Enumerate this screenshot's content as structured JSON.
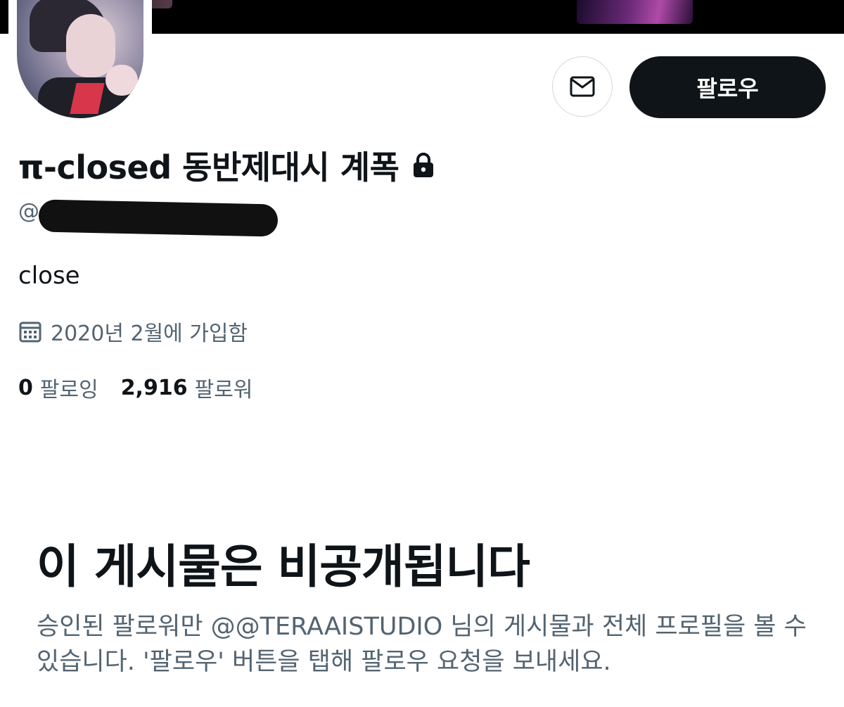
{
  "header": {
    "banner_alt": "banner-image"
  },
  "profile": {
    "display_name": "π-closed 동반제대시 계폭",
    "handle_prefix": "@",
    "bio": "close",
    "joined": "2020년 2월에 가입함",
    "following_count": "0",
    "following_label": "팔로잉",
    "followers_count": "2,916",
    "followers_label": "팔로워"
  },
  "actions": {
    "follow_label": "팔로우",
    "message_icon": "envelope-icon"
  },
  "private_notice": {
    "title": "이 게시물은 비공개됩니다",
    "description": "승인된 팔로워만 @@TERAAISTUDIO 님의 게시물과 전체 프로필을 볼 수 있습니다. '팔로우' 버튼을 탭해 팔로우 요청을 보내세요."
  },
  "colors": {
    "primary_text": "#0f1419",
    "secondary_text": "#536471",
    "button_dark": "#0f1419",
    "border": "#cfd9de"
  }
}
